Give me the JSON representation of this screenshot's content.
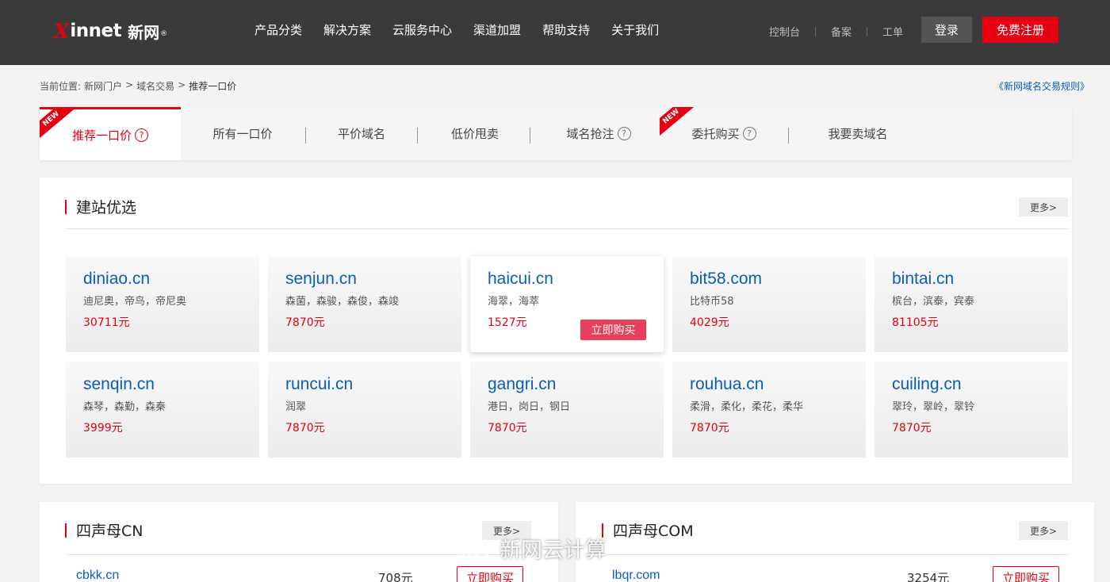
{
  "header": {
    "logo": {
      "mark": "X",
      "word": "innet",
      "cn": "新网",
      "reg": "®"
    },
    "nav": [
      "产品分类",
      "解决方案",
      "云服务中心",
      "渠道加盟",
      "帮助支持",
      "关于我们"
    ],
    "links": [
      "控制台",
      "备案",
      "工单"
    ],
    "login": "登录",
    "register": "免费注册"
  },
  "breadcrumb": {
    "prefix": "当前位置:",
    "items": [
      "新网门户",
      "域名交易",
      "推荐一口价"
    ],
    "separator": ">"
  },
  "rules_link": "《新网域名交易规则》",
  "tabs": [
    {
      "label": "推荐一口价",
      "help": "?",
      "badge": "NEW",
      "active": true
    },
    {
      "label": "所有一口价"
    },
    {
      "label": "平价域名"
    },
    {
      "label": "低价甩卖"
    },
    {
      "label": "域名抢注",
      "help": "?"
    },
    {
      "label": "委托购买",
      "help": "?",
      "badge": "NEW"
    },
    {
      "label": "我要卖域名"
    }
  ],
  "featured": {
    "title": "建站优选",
    "more": "更多>",
    "buy_label": "立即购买",
    "cards": [
      {
        "domain": "diniao.cn",
        "meaning": "迪尼奥，帝鸟，帝尼奥",
        "price": "30711元"
      },
      {
        "domain": "senjun.cn",
        "meaning": "森菌，森骏，森俊，森竣",
        "price": "7870元"
      },
      {
        "domain": "haicui.cn",
        "meaning": "海翠，海萃",
        "price": "1527元",
        "hover": true
      },
      {
        "domain": "bit58.com",
        "meaning": "比特币58",
        "price": "4029元"
      },
      {
        "domain": "bintai.cn",
        "meaning": "槟台，滨泰，宾泰",
        "price": "81105元"
      },
      {
        "domain": "senqin.cn",
        "meaning": "森琴，森勤，森秦",
        "price": "3999元"
      },
      {
        "domain": "runcui.cn",
        "meaning": "润翠",
        "price": "7870元"
      },
      {
        "domain": "gangri.cn",
        "meaning": "港日，岗日，钢日",
        "price": "7870元"
      },
      {
        "domain": "rouhua.cn",
        "meaning": "柔滑，柔化，柔花，柔华",
        "price": "7870元"
      },
      {
        "domain": "cuiling.cn",
        "meaning": "翠玲，翠岭，翠铃",
        "price": "7870元"
      }
    ]
  },
  "cn_section": {
    "title": "四声母CN",
    "more": "更多>",
    "rows": [
      {
        "domain": "cbkk.cn",
        "price": "708元",
        "buy": "立即购买"
      }
    ]
  },
  "com_section": {
    "title": "四声母COM",
    "more": "更多>",
    "rows": [
      {
        "domain": "lbqr.com",
        "price": "3254元",
        "buy": "立即购买"
      }
    ]
  },
  "watermark": "新网云计算"
}
